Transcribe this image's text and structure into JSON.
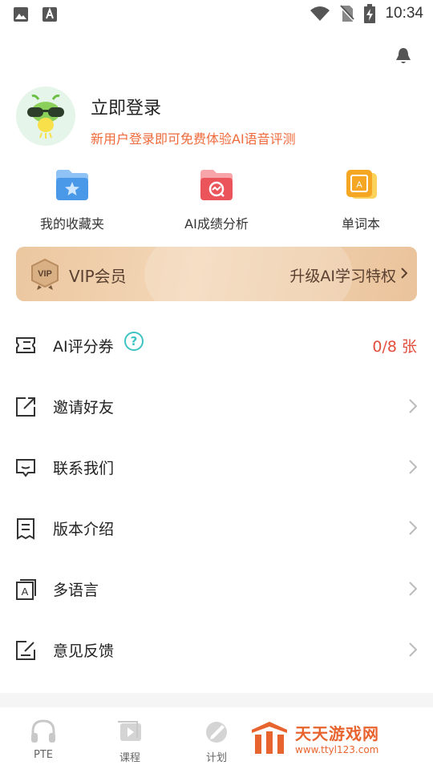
{
  "status_bar": {
    "time": "10:34"
  },
  "profile": {
    "title": "立即登录",
    "subtitle": "新用户登录即可免费体验AI语音评测"
  },
  "quick_actions": [
    {
      "label": "我的收藏夹",
      "icon": "favorites-folder-icon"
    },
    {
      "label": "AI成绩分析",
      "icon": "score-analysis-icon"
    },
    {
      "label": "单词本",
      "icon": "wordbook-icon"
    }
  ],
  "vip": {
    "badge": "VIP",
    "title": "VIP会员",
    "cta": "升级AI学习特权"
  },
  "menu": [
    {
      "label": "AI评分券",
      "icon": "ticket-icon",
      "value": "0/8 张"
    },
    {
      "label": "邀请好友",
      "icon": "share-icon"
    },
    {
      "label": "联系我们",
      "icon": "message-icon"
    },
    {
      "label": "版本介绍",
      "icon": "document-icon"
    },
    {
      "label": "多语言",
      "icon": "language-icon",
      "icon_letter": "A"
    },
    {
      "label": "意见反馈",
      "icon": "feedback-icon"
    }
  ],
  "tabbar": {
    "tabs": [
      {
        "label": "PTE",
        "icon": "headphones-icon"
      },
      {
        "label": "课程",
        "icon": "course-icon"
      },
      {
        "label": "计划",
        "icon": "plan-icon"
      }
    ]
  },
  "watermark": {
    "name": "天天游戏网",
    "url": "www.ttyl123.com"
  },
  "colors": {
    "accent_orange": "#ef6a3a",
    "count_red": "#e34d3d",
    "help_teal": "#3ec3c2",
    "vip_gold": "#ecc7a0"
  }
}
